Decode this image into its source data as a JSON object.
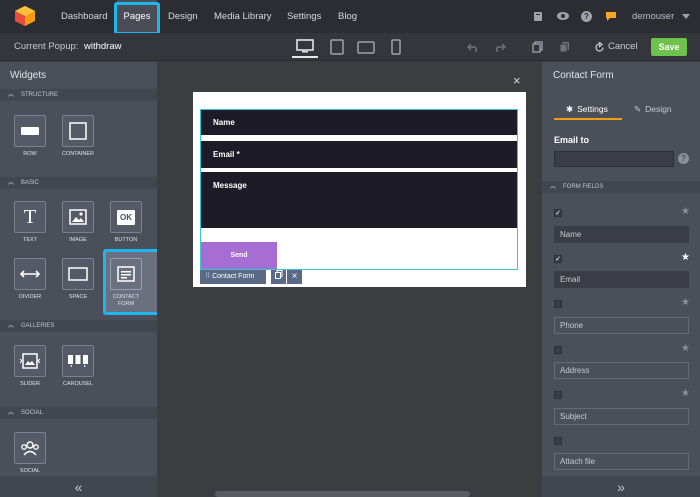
{
  "topnav": {
    "items": [
      "Dashboard",
      "Pages",
      "Design",
      "Media Library",
      "Settings",
      "Blog"
    ],
    "active_item": "Pages",
    "user": "demouser"
  },
  "toolbar": {
    "current_popup_label": "Current Popup:",
    "current_popup_value": "withdraw",
    "cancel_label": "Cancel",
    "save_label": "Save"
  },
  "left_panel": {
    "title": "Widgets",
    "sections": {
      "structure": "STRUCTURE",
      "basic": "BASIC",
      "galleries": "GALLERIES",
      "social": "SOCIAL"
    },
    "widgets": {
      "row": "ROW",
      "container": "CONTAINER",
      "text": "TEXT",
      "image": "IMAGE",
      "button": "BUTTON",
      "button_glyph": "OK",
      "divider": "DIVIDER",
      "space": "SPACE",
      "contact_form_1": "CONTACT",
      "contact_form_2": "FORM",
      "slider": "SLIDER",
      "carousel": "CAROUSEL",
      "social": "SOCIAL"
    }
  },
  "canvas": {
    "form_fields": [
      "Name",
      "Email *",
      "Message"
    ],
    "send_label": "Send",
    "tag_label": "Contact Form",
    "close_glyph": "×"
  },
  "right_panel": {
    "title": "Contact Form",
    "tab_settings": "Settings",
    "tab_design": "Design",
    "email_to_label": "Email to",
    "help_glyph": "?",
    "form_fields_section": "FORM FIELDS",
    "fields": [
      {
        "label": "Name",
        "checked": true
      },
      {
        "label": "Email",
        "checked": true
      },
      {
        "label": "Phone",
        "checked": false
      },
      {
        "label": "Address",
        "checked": false
      },
      {
        "label": "Subject",
        "checked": false
      },
      {
        "label": "Attach file",
        "checked": false
      }
    ]
  },
  "colors": {
    "accent_highlight": "#1fb6ee",
    "save_green": "#6cc24a",
    "send_purple": "#a66dd4",
    "selection_teal": "#39c6d0"
  }
}
